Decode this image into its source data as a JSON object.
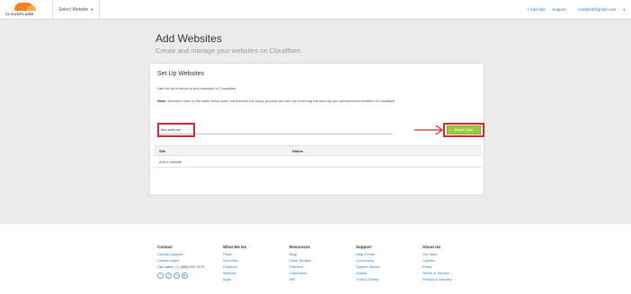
{
  "header": {
    "logo_text": "CLOUDFLARE",
    "site_select_label": "Select Website",
    "links": [
      "+ Add Site",
      "Support",
      "craftyled@gmail.com"
    ]
  },
  "page": {
    "title": "Add Websites",
    "subtitle": "Create and manage your websites on Cloudflare."
  },
  "panel": {
    "title": "Set Up Websites",
    "description": "Use the form below to add websites to Cloudflare.",
    "note_label": "Note:",
    "note_text": "Websites seen in the table below have not finished the setup process and are not receiving the security and performance benefits of Cloudflare.",
    "input_value": "dev-web.net",
    "input_placeholder": "",
    "button_label": "Begin Scan"
  },
  "table": {
    "headers": [
      "Site",
      "Status"
    ],
    "empty_row": "Add a website"
  },
  "footer": {
    "columns": [
      {
        "heading": "Contact",
        "links": [
          "Contact support",
          "Contact sales"
        ],
        "phone": "Call sales: +1 (888) 993 5273"
      },
      {
        "heading": "What We Do",
        "links": [
          "Plans",
          "Overview",
          "Features",
          "Network",
          "Apps"
        ]
      },
      {
        "heading": "Resources",
        "links": [
          "Blog",
          "Case Studies",
          "Partners",
          "Customers",
          "API"
        ]
      },
      {
        "heading": "Support",
        "links": [
          "Help Center",
          "Community",
          "System Status",
          "Videos",
          "Trust & Safety"
        ]
      },
      {
        "heading": "About Us",
        "links": [
          "Our team",
          "Careers",
          "Press",
          "Terms of Service",
          "Privacy & Security"
        ]
      }
    ],
    "social_icons": [
      "twitter-icon",
      "facebook-icon",
      "linkedin-icon",
      "youtube-icon"
    ]
  },
  "colors": {
    "accent_orange": "#f48120",
    "button_green": "#9bca3e",
    "highlight_red": "#d9232d",
    "link_blue": "#2f7bbf",
    "background_gray": "#ebebeb"
  }
}
